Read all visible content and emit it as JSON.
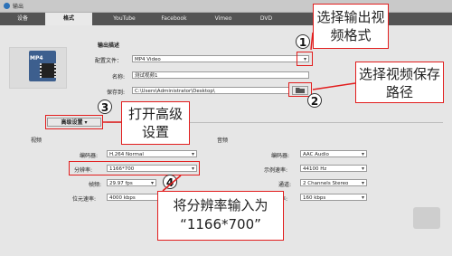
{
  "window": {
    "title": "输出"
  },
  "tabs": [
    "设备",
    "格式",
    "YouTube",
    "Facebook",
    "Vimeo",
    "DVD"
  ],
  "format_icon": {
    "label": "MP4",
    "icon": "mp4-film-icon"
  },
  "output_desc": {
    "heading": "输出描述",
    "profile_label": "配置文件：",
    "profile_value": "MP4 Video",
    "name_label": "名称:",
    "name_value": "测试视频1",
    "save_label": "保存到:",
    "save_value": "C:\\Users\\Administrator\\Desktop\\"
  },
  "advanced": {
    "label": "高级设置"
  },
  "video": {
    "heading": "视频",
    "encoder_label": "编码器:",
    "encoder_value": "H.264 Normal",
    "resolution_label": "分辨率:",
    "resolution_value": "1166*700",
    "framerate_label": "帧频:",
    "framerate_value": "29.97 fps",
    "bitrate_label": "位元速率:",
    "bitrate_value": "4000 kbps"
  },
  "audio": {
    "heading": "音频",
    "encoder_label": "编码器:",
    "encoder_value": "AAC Audio",
    "samplerate_label": "示例速率:",
    "samplerate_value": "44100 Hz",
    "channel_label": "通道:",
    "channel_value": "2 Channels Stereo",
    "bitrate_label": "位元速率:",
    "bitrate_value": "160 kbps"
  },
  "annotations": {
    "n1": "1",
    "n2": "2",
    "n3": "3",
    "n4": "4",
    "c1": "选择输出视频格式",
    "c2": "选择视频保存路径",
    "c3": "打开高级设置",
    "c4_line1": "将分辨率输入为",
    "c4_line2": "“1166*700”"
  },
  "colors": {
    "annotation_red": "#e21d1d",
    "tabbar": "#545454",
    "panel": "#e6e6e6"
  }
}
